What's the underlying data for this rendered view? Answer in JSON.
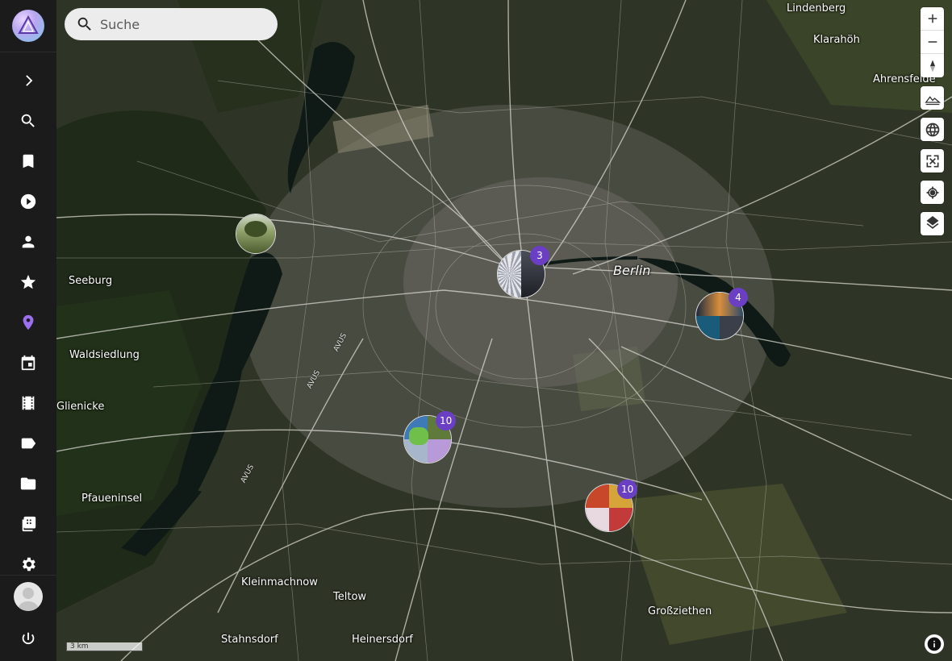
{
  "search": {
    "placeholder": "Suche",
    "icon": "search-icon"
  },
  "sidebar": {
    "items": [
      {
        "name": "expand",
        "icon": "chevron-right-icon",
        "active": false
      },
      {
        "name": "search",
        "icon": "search-icon",
        "active": false
      },
      {
        "name": "bookmarks",
        "icon": "bookmark-icon",
        "active": false
      },
      {
        "name": "slideshow",
        "icon": "play-circle-icon",
        "active": false
      },
      {
        "name": "people",
        "icon": "person-icon",
        "active": false
      },
      {
        "name": "favorites",
        "icon": "star-icon",
        "active": false
      },
      {
        "name": "places",
        "icon": "map-marker-icon",
        "active": true
      },
      {
        "name": "calendar",
        "icon": "calendar-icon",
        "active": false
      },
      {
        "name": "videos",
        "icon": "film-icon",
        "active": false
      },
      {
        "name": "labels",
        "icon": "label-icon",
        "active": false
      },
      {
        "name": "folders",
        "icon": "folder-icon",
        "active": false
      },
      {
        "name": "library",
        "icon": "library-icon",
        "active": false
      },
      {
        "name": "settings",
        "icon": "gear-icon",
        "active": false
      }
    ],
    "logout_icon": "power-icon",
    "accent": "#9a6ff0"
  },
  "map": {
    "places": {
      "lindenberg": "Lindenberg",
      "klarahoh": "Klarahöh",
      "ahrensfelde": "Ahrensfelde",
      "berlin": "Berlin",
      "seeburg": "Seeburg",
      "waldsiedlung": "Waldsiedlung",
      "glienicke": "Glienicke",
      "pfaueninsel": "Pfaueninsel",
      "kleinmachnow": "Kleinmachnow",
      "teltow": "Teltow",
      "grossziethen": "Großziethen",
      "stahnsdorf": "Stahnsdorf",
      "heinersdorf": "Heinersdorf"
    },
    "roads": {
      "avus1": "AVUS",
      "avus2": "AVUS",
      "avus3": "AVUS"
    },
    "clusters": [
      {
        "count": "",
        "label": "single-photo"
      },
      {
        "count": "3"
      },
      {
        "count": "4"
      },
      {
        "count": "10"
      },
      {
        "count": "10"
      }
    ],
    "scale": "3 km",
    "badge_color": "#6a3fc4"
  },
  "controls": {
    "zoom_in": "zoom-in-icon",
    "zoom_out": "zoom-out-icon",
    "compass": "compass-icon",
    "terrain": "terrain-icon",
    "globe": "globe-icon",
    "fullscreen": "fullscreen-icon",
    "locate": "locate-icon",
    "layers": "layers-icon",
    "info": "info-icon"
  }
}
